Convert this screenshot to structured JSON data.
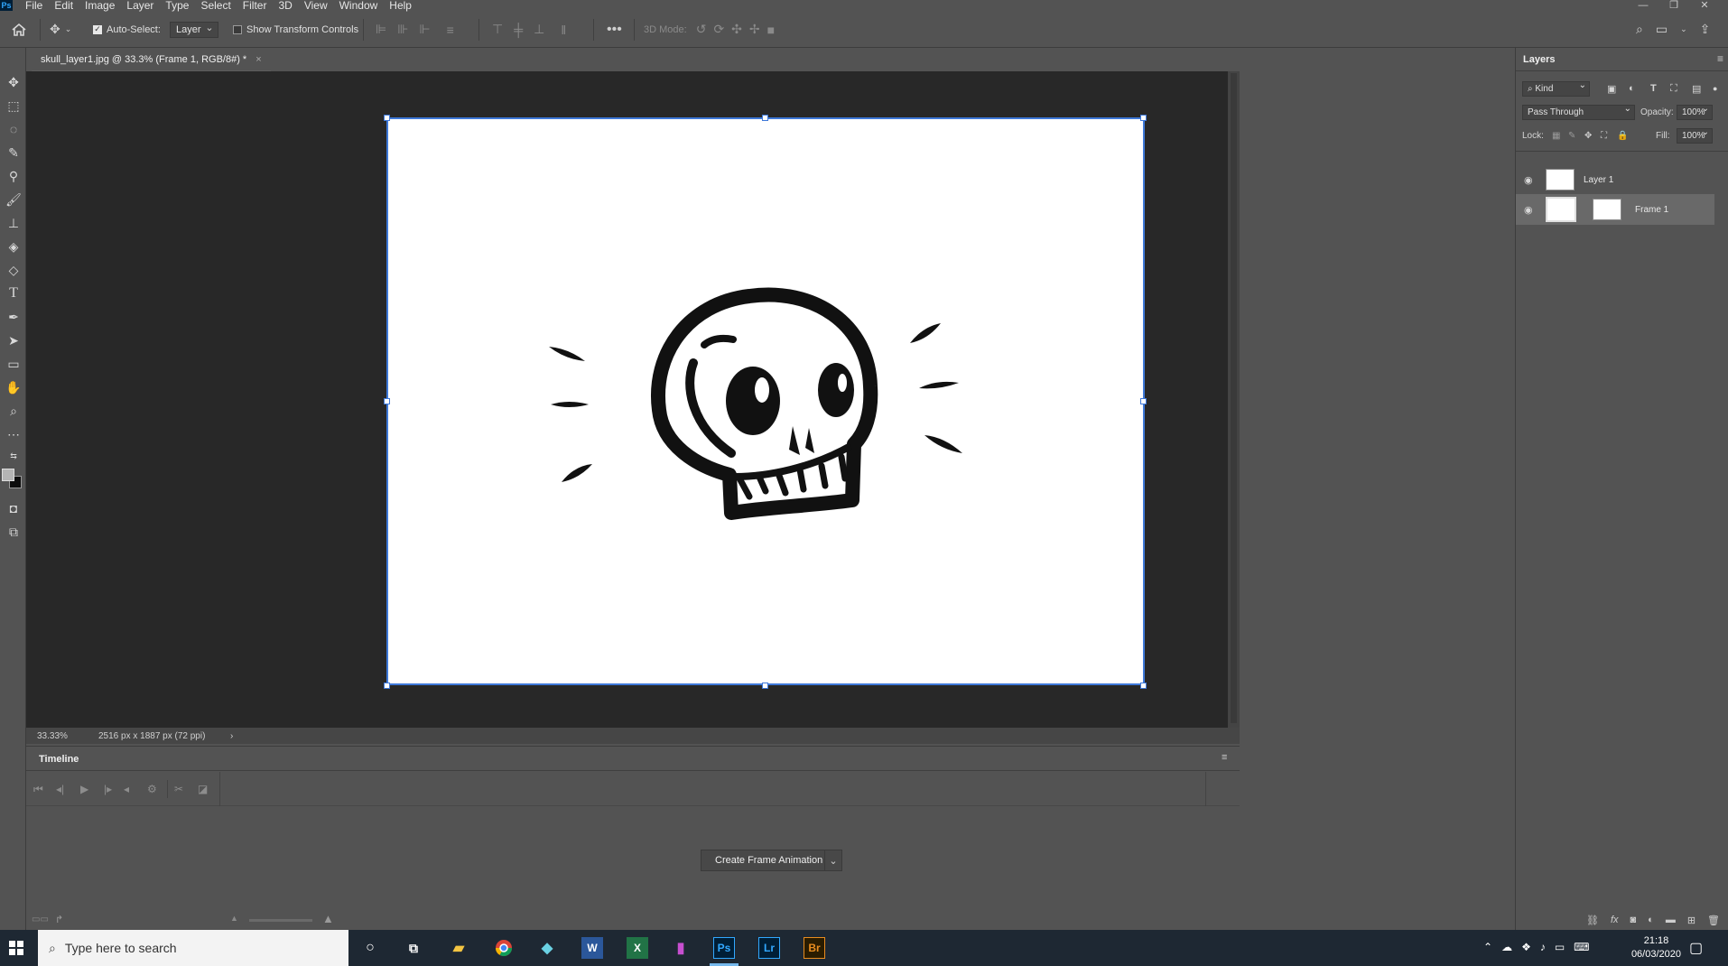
{
  "app": {
    "logo": "Ps"
  },
  "menu": {
    "items": [
      "File",
      "Edit",
      "Image",
      "Layer",
      "Type",
      "Select",
      "Filter",
      "3D",
      "View",
      "Window",
      "Help"
    ]
  },
  "window_controls": {
    "minimize": "—",
    "restore": "❐",
    "close": "✕"
  },
  "options": {
    "auto_select_label": "Auto-Select:",
    "auto_select_target": "Layer",
    "show_transform_label": "Show Transform Controls",
    "mode_3d_label": "3D Mode:"
  },
  "document": {
    "tab_title": "skull_layer1.jpg @ 33.3% (Frame 1, RGB/8#) *",
    "close_glyph": "×"
  },
  "status": {
    "zoom": "33.33%",
    "doc_info": "2516 px x 1887 px (72 ppi)",
    "arrow": "›"
  },
  "timeline": {
    "title": "Timeline",
    "create_button": "Create Frame Animation"
  },
  "layers_panel": {
    "title": "Layers",
    "filter_kind": "Kind",
    "blend_mode": "Pass Through",
    "opacity_label": "Opacity:",
    "opacity_value": "100%",
    "lock_label": "Lock:",
    "fill_label": "Fill:",
    "fill_value": "100%",
    "layers": [
      {
        "name": "Layer 1",
        "visible": true,
        "selected": false
      },
      {
        "name": "Frame 1",
        "visible": true,
        "selected": true
      }
    ]
  },
  "taskbar": {
    "search_placeholder": "Type here to search",
    "time": "21:18",
    "date": "06/03/2020",
    "app_labels": {
      "word": "W",
      "excel": "X",
      "photoshop": "Ps",
      "lightroom": "Lr",
      "bridge": "Br"
    }
  },
  "colors": {
    "accent_selection": "#3e78d8",
    "ps_blue": "#31a8ff",
    "panel_bg": "#535353",
    "canvas_bg": "#282828"
  }
}
